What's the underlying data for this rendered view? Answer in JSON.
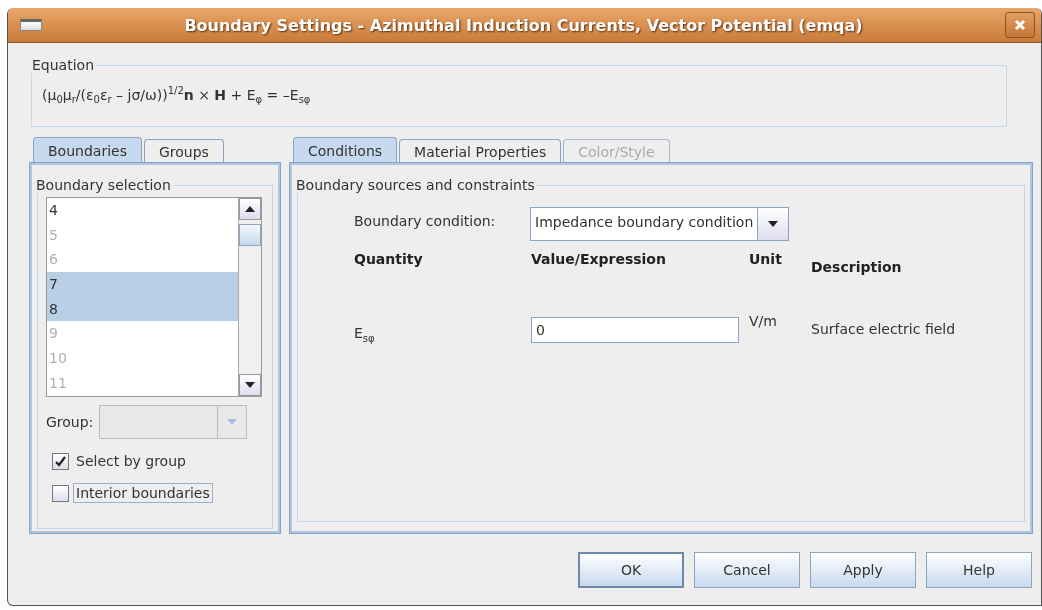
{
  "window": {
    "title": "Boundary Settings - Azimuthal Induction Currents, Vector Potential (emqa)"
  },
  "equation": {
    "label": "Equation",
    "text": "(μ$_{0}$μ$_{r}$/(ε$_{0}$ε$_{r}$ – jσ/ω))$^{1/2}$**n** × **H** + E$_{φ}$ = –E$_{sφ}$"
  },
  "left_tabs": [
    {
      "label": "Boundaries",
      "selected": true
    },
    {
      "label": "Groups",
      "selected": false
    }
  ],
  "boundary_selection": {
    "label": "Boundary selection",
    "items": [
      {
        "label": "4",
        "selected": false,
        "disabled": false
      },
      {
        "label": "5",
        "selected": false,
        "disabled": true
      },
      {
        "label": "6",
        "selected": false,
        "disabled": true
      },
      {
        "label": "7",
        "selected": true,
        "disabled": false
      },
      {
        "label": "8",
        "selected": true,
        "disabled": false
      },
      {
        "label": "9",
        "selected": false,
        "disabled": true
      },
      {
        "label": "10",
        "selected": false,
        "disabled": true
      },
      {
        "label": "11",
        "selected": false,
        "disabled": true
      }
    ],
    "group": {
      "label": "Group:",
      "disabled": true
    },
    "options": [
      {
        "label": "Select by group",
        "checked": true,
        "focused": false
      },
      {
        "label": "Interior boundaries",
        "checked": false,
        "focused": true
      }
    ]
  },
  "right_tabs": [
    {
      "label": "Conditions",
      "selected": true,
      "disabled": false
    },
    {
      "label": "Material Properties",
      "selected": false,
      "disabled": false
    },
    {
      "label": "Color/Style",
      "selected": false,
      "disabled": true
    }
  ],
  "conditions": {
    "label": "Boundary sources and constraints",
    "boundary_condition": {
      "label": "Boundary condition:",
      "value": "Impedance boundary condition"
    },
    "columns": [
      "Quantity",
      "Value/Expression",
      "Unit",
      "Description"
    ],
    "rows": [
      {
        "quantity": "E$_{sφ}$",
        "value": "0",
        "unit": "V/m",
        "description": "Surface electric field"
      }
    ]
  },
  "buttons": [
    {
      "label": "OK",
      "default": true
    },
    {
      "label": "Cancel",
      "default": false
    },
    {
      "label": "Apply",
      "default": false
    },
    {
      "label": "Help",
      "default": false
    }
  ]
}
